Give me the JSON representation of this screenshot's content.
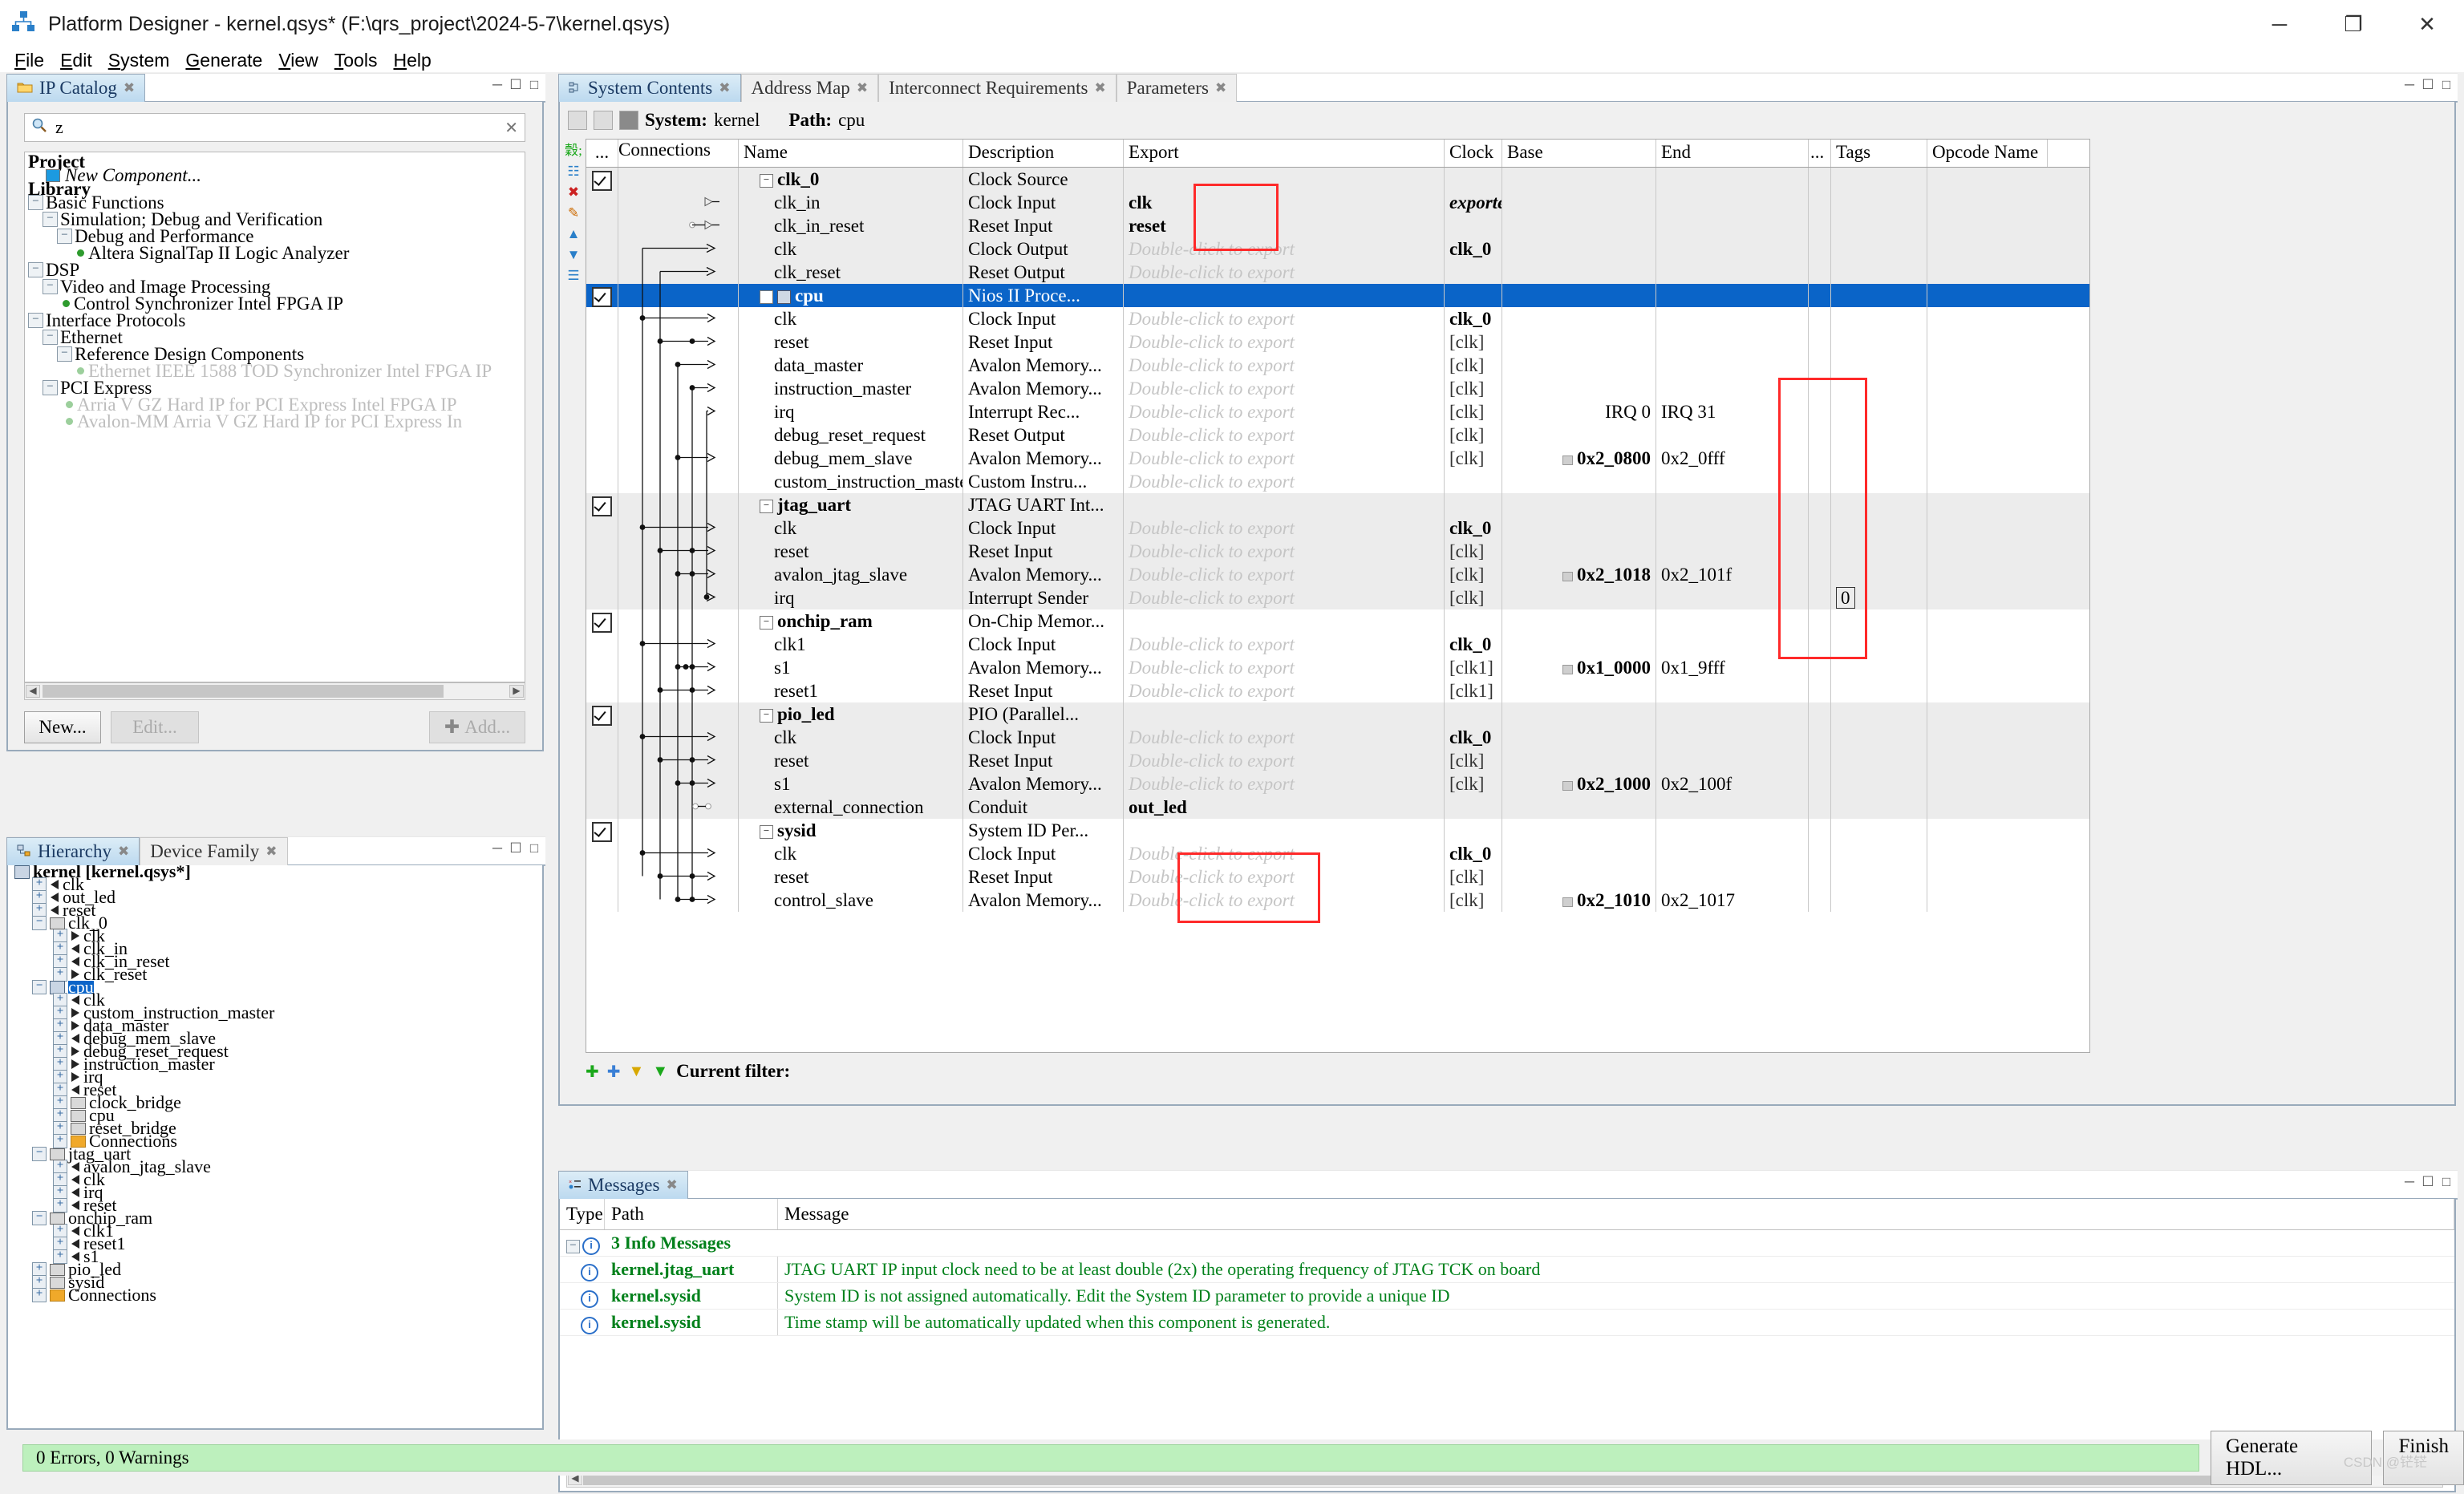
{
  "window": {
    "title": "Platform Designer - kernel.qsys* (F:\\qrs_project\\2024-5-7\\kernel.qsys)",
    "icon": "platform-designer-icon",
    "minimize": "─",
    "maximize": "❐",
    "close": "✕"
  },
  "menubar": [
    {
      "label": "File",
      "mnemonic": "F"
    },
    {
      "label": "Edit",
      "mnemonic": "E"
    },
    {
      "label": "System",
      "mnemonic": "S"
    },
    {
      "label": "Generate",
      "mnemonic": "G"
    },
    {
      "label": "View",
      "mnemonic": "V"
    },
    {
      "label": "Tools",
      "mnemonic": "T"
    },
    {
      "label": "Help",
      "mnemonic": "H"
    }
  ],
  "ip_catalog": {
    "tab_label": "IP Catalog",
    "search_value": "z",
    "search_placeholder": "",
    "tree": [
      {
        "label": "Project",
        "indent": 0,
        "style": "bold",
        "kind": "group"
      },
      {
        "label": "New Component...",
        "indent": 1,
        "style": "italic",
        "kind": "new"
      },
      {
        "label": "Library",
        "indent": 0,
        "style": "bold",
        "kind": "group"
      },
      {
        "label": "Basic Functions",
        "indent": 0,
        "style": "normal",
        "kind": "expander",
        "expander": "-"
      },
      {
        "label": "Simulation; Debug and Verification",
        "indent": 1,
        "style": "normal",
        "kind": "expander",
        "expander": "-"
      },
      {
        "label": "Debug and Performance",
        "indent": 2,
        "style": "normal",
        "kind": "expander",
        "expander": "-"
      },
      {
        "label": "Altera SignalTap II Logic Analyzer",
        "indent": 3,
        "style": "normal",
        "kind": "leaf"
      },
      {
        "label": "DSP",
        "indent": 0,
        "style": "normal",
        "kind": "expander",
        "expander": "-"
      },
      {
        "label": "Video and Image Processing",
        "indent": 1,
        "style": "normal",
        "kind": "expander",
        "expander": "-"
      },
      {
        "label": "Control Synchronizer Intel FPGA IP",
        "indent": 2,
        "style": "normal",
        "kind": "leaf"
      },
      {
        "label": "Interface Protocols",
        "indent": 0,
        "style": "normal",
        "kind": "expander",
        "expander": "-"
      },
      {
        "label": "Ethernet",
        "indent": 1,
        "style": "normal",
        "kind": "expander",
        "expander": "-"
      },
      {
        "label": "Reference Design Components",
        "indent": 2,
        "style": "normal",
        "kind": "expander",
        "expander": "-"
      },
      {
        "label": "Ethernet IEEE 1588 TOD Synchronizer Intel FPGA IP",
        "indent": 3,
        "style": "grey",
        "kind": "leaf-grey"
      },
      {
        "label": "PCI Express",
        "indent": 1,
        "style": "normal",
        "kind": "expander",
        "expander": "-"
      },
      {
        "label": "Arria V GZ Hard IP for PCI Express Intel FPGA IP",
        "indent": 2,
        "style": "grey",
        "kind": "leaf-grey"
      },
      {
        "label": "Avalon-MM Arria V GZ Hard IP for PCI Express In",
        "indent": 2,
        "style": "grey",
        "kind": "leaf-grey"
      }
    ],
    "buttons": {
      "new": "New...",
      "edit": "Edit...",
      "add": "Add..."
    }
  },
  "hierarchy": {
    "tabs": [
      {
        "label": "Hierarchy",
        "active": true
      },
      {
        "label": "Device Family",
        "active": false
      }
    ],
    "tree": [
      {
        "label": "kernel [kernel.qsys*]",
        "indent": 0,
        "icon": "system",
        "toggle": "",
        "bold": true
      },
      {
        "label": "clk",
        "indent": 1,
        "icon": "port-out",
        "toggle": "+"
      },
      {
        "label": "out_led",
        "indent": 1,
        "icon": "port-out",
        "toggle": "+"
      },
      {
        "label": "reset",
        "indent": 1,
        "icon": "port-out",
        "toggle": "+"
      },
      {
        "label": "clk_0",
        "indent": 1,
        "icon": "module",
        "toggle": "-"
      },
      {
        "label": "clk",
        "indent": 2,
        "icon": "port-in",
        "toggle": "+"
      },
      {
        "label": "clk_in",
        "indent": 2,
        "icon": "port-out",
        "toggle": "+"
      },
      {
        "label": "clk_in_reset",
        "indent": 2,
        "icon": "port-out",
        "toggle": "+"
      },
      {
        "label": "clk_reset",
        "indent": 2,
        "icon": "port-in",
        "toggle": "+"
      },
      {
        "label": "cpu",
        "indent": 1,
        "icon": "system",
        "toggle": "-",
        "selected": true
      },
      {
        "label": "clk",
        "indent": 2,
        "icon": "port-out",
        "toggle": "+"
      },
      {
        "label": "custom_instruction_master",
        "indent": 2,
        "icon": "port-in",
        "toggle": "+"
      },
      {
        "label": "data_master",
        "indent": 2,
        "icon": "port-in",
        "toggle": "+"
      },
      {
        "label": "debug_mem_slave",
        "indent": 2,
        "icon": "port-out",
        "toggle": "+"
      },
      {
        "label": "debug_reset_request",
        "indent": 2,
        "icon": "port-in",
        "toggle": "+"
      },
      {
        "label": "instruction_master",
        "indent": 2,
        "icon": "port-in",
        "toggle": "+"
      },
      {
        "label": "irq",
        "indent": 2,
        "icon": "port-in",
        "toggle": "+"
      },
      {
        "label": "reset",
        "indent": 2,
        "icon": "port-out",
        "toggle": "+"
      },
      {
        "label": "clock_bridge",
        "indent": 2,
        "icon": "module",
        "toggle": "+"
      },
      {
        "label": "cpu",
        "indent": 2,
        "icon": "module",
        "toggle": "+"
      },
      {
        "label": "reset_bridge",
        "indent": 2,
        "icon": "module",
        "toggle": "+"
      },
      {
        "label": "Connections",
        "indent": 2,
        "icon": "folder",
        "toggle": "+"
      },
      {
        "label": "jtag_uart",
        "indent": 1,
        "icon": "module",
        "toggle": "-"
      },
      {
        "label": "avalon_jtag_slave",
        "indent": 2,
        "icon": "port-out",
        "toggle": "+"
      },
      {
        "label": "clk",
        "indent": 2,
        "icon": "port-out",
        "toggle": "+"
      },
      {
        "label": "irq",
        "indent": 2,
        "icon": "port-out",
        "toggle": "+"
      },
      {
        "label": "reset",
        "indent": 2,
        "icon": "port-out",
        "toggle": "+"
      },
      {
        "label": "onchip_ram",
        "indent": 1,
        "icon": "module",
        "toggle": "-"
      },
      {
        "label": "clk1",
        "indent": 2,
        "icon": "port-out",
        "toggle": "+"
      },
      {
        "label": "reset1",
        "indent": 2,
        "icon": "port-out",
        "toggle": "+"
      },
      {
        "label": "s1",
        "indent": 2,
        "icon": "port-out",
        "toggle": "+"
      },
      {
        "label": "pio_led",
        "indent": 1,
        "icon": "module",
        "toggle": "+"
      },
      {
        "label": "sysid",
        "indent": 1,
        "icon": "module",
        "toggle": "+"
      },
      {
        "label": "Connections",
        "indent": 1,
        "icon": "folder",
        "toggle": "+"
      }
    ]
  },
  "system_contents": {
    "tabs": [
      {
        "label": "System Contents",
        "active": true
      },
      {
        "label": "Address Map",
        "active": false
      },
      {
        "label": "Interconnect Requirements",
        "active": false
      },
      {
        "label": "Parameters",
        "active": false
      }
    ],
    "toolbar": {
      "system_label": "System:",
      "system_value": "kernel",
      "path_label": "Path:",
      "path_value": "cpu"
    },
    "columns": [
      "...",
      "Connections",
      "Name",
      "Description",
      "Export",
      "Clock",
      "Base",
      "End",
      "...",
      "Tags",
      "Opcode Name"
    ],
    "rows": [
      {
        "use": true,
        "name": "clk_0",
        "level": 0,
        "desc": "Clock Source",
        "export": "",
        "clock": "",
        "base": "",
        "end": "",
        "tags": "",
        "opcode": "",
        "alt": true,
        "selected": false
      },
      {
        "use": null,
        "name": "clk_in",
        "level": 1,
        "desc": "Clock Input",
        "export": "clk",
        "clock": "exported",
        "base": "",
        "end": "",
        "tags": "",
        "opcode": "",
        "alt": true,
        "selected": false
      },
      {
        "use": null,
        "name": "clk_in_reset",
        "level": 1,
        "desc": "Reset Input",
        "export": "reset",
        "clock": "",
        "base": "",
        "end": "",
        "tags": "",
        "opcode": "",
        "alt": true,
        "selected": false
      },
      {
        "use": null,
        "name": "clk",
        "level": 1,
        "desc": "Clock Output",
        "export": "Double-click to export",
        "clock": "clk_0",
        "base": "",
        "end": "",
        "tags": "",
        "opcode": "",
        "alt": true,
        "selected": false
      },
      {
        "use": null,
        "name": "clk_reset",
        "level": 1,
        "desc": "Reset Output",
        "export": "Double-click to export",
        "clock": "",
        "base": "",
        "end": "",
        "tags": "",
        "opcode": "",
        "alt": true,
        "selected": false
      },
      {
        "use": true,
        "name": "cpu",
        "level": 0,
        "desc": "Nios II Proce...",
        "export": "",
        "clock": "",
        "base": "",
        "end": "",
        "tags": "",
        "opcode": "",
        "alt": false,
        "selected": true
      },
      {
        "use": null,
        "name": "clk",
        "level": 1,
        "desc": "Clock Input",
        "export": "Double-click to export",
        "clock": "clk_0",
        "base": "",
        "end": "",
        "tags": "",
        "opcode": "",
        "alt": false,
        "selected": false
      },
      {
        "use": null,
        "name": "reset",
        "level": 1,
        "desc": "Reset Input",
        "export": "Double-click to export",
        "clock": "[clk]",
        "base": "",
        "end": "",
        "tags": "",
        "opcode": "",
        "alt": false,
        "selected": false
      },
      {
        "use": null,
        "name": "data_master",
        "level": 1,
        "desc": "Avalon Memory...",
        "export": "Double-click to export",
        "clock": "[clk]",
        "base": "",
        "end": "",
        "tags": "",
        "opcode": "",
        "alt": false,
        "selected": false
      },
      {
        "use": null,
        "name": "instruction_master",
        "level": 1,
        "desc": "Avalon Memory...",
        "export": "Double-click to export",
        "clock": "[clk]",
        "base": "",
        "end": "",
        "tags": "",
        "opcode": "",
        "alt": false,
        "selected": false
      },
      {
        "use": null,
        "name": "irq",
        "level": 1,
        "desc": "Interrupt Rec...",
        "export": "Double-click to export",
        "clock": "[clk]",
        "base": "IRQ 0",
        "end": "IRQ 31",
        "tags": "",
        "opcode": "",
        "alt": false,
        "selected": false
      },
      {
        "use": null,
        "name": "debug_reset_request",
        "level": 1,
        "desc": "Reset Output",
        "export": "Double-click to export",
        "clock": "[clk]",
        "base": "",
        "end": "",
        "tags": "",
        "opcode": "",
        "alt": false,
        "selected": false
      },
      {
        "use": null,
        "name": "debug_mem_slave",
        "level": 1,
        "desc": "Avalon Memory...",
        "export": "Double-click to export",
        "clock": "[clk]",
        "base": "0x2_0800",
        "end": "0x2_0fff",
        "tags": "",
        "opcode": "",
        "alt": false,
        "selected": false,
        "lock": true
      },
      {
        "use": null,
        "name": "custom_instruction_master",
        "level": 1,
        "desc": "Custom Instru...",
        "export": "Double-click to export",
        "clock": "",
        "base": "",
        "end": "",
        "tags": "",
        "opcode": "",
        "alt": false,
        "selected": false
      },
      {
        "use": true,
        "name": "jtag_uart",
        "level": 0,
        "desc": "JTAG UART Int...",
        "export": "",
        "clock": "",
        "base": "",
        "end": "",
        "tags": "",
        "opcode": "",
        "alt": true,
        "selected": false
      },
      {
        "use": null,
        "name": "clk",
        "level": 1,
        "desc": "Clock Input",
        "export": "Double-click to export",
        "clock": "clk_0",
        "base": "",
        "end": "",
        "tags": "",
        "opcode": "",
        "alt": true,
        "selected": false
      },
      {
        "use": null,
        "name": "reset",
        "level": 1,
        "desc": "Reset Input",
        "export": "Double-click to export",
        "clock": "[clk]",
        "base": "",
        "end": "",
        "tags": "",
        "opcode": "",
        "alt": true,
        "selected": false
      },
      {
        "use": null,
        "name": "avalon_jtag_slave",
        "level": 1,
        "desc": "Avalon Memory...",
        "export": "Double-click to export",
        "clock": "[clk]",
        "base": "0x2_1018",
        "end": "0x2_101f",
        "tags": "",
        "opcode": "",
        "alt": true,
        "selected": false,
        "lock": true
      },
      {
        "use": null,
        "name": "irq",
        "level": 1,
        "desc": "Interrupt Sender",
        "export": "Double-click to export",
        "clock": "[clk]",
        "base": "",
        "end": "",
        "tags": "0",
        "opcode": "",
        "alt": true,
        "selected": false
      },
      {
        "use": true,
        "name": "onchip_ram",
        "level": 0,
        "desc": "On-Chip Memor...",
        "export": "",
        "clock": "",
        "base": "",
        "end": "",
        "tags": "",
        "opcode": "",
        "alt": false,
        "selected": false
      },
      {
        "use": null,
        "name": "clk1",
        "level": 1,
        "desc": "Clock Input",
        "export": "Double-click to export",
        "clock": "clk_0",
        "base": "",
        "end": "",
        "tags": "",
        "opcode": "",
        "alt": false,
        "selected": false
      },
      {
        "use": null,
        "name": "s1",
        "level": 1,
        "desc": "Avalon Memory...",
        "export": "Double-click to export",
        "clock": "[clk1]",
        "base": "0x1_0000",
        "end": "0x1_9fff",
        "tags": "",
        "opcode": "",
        "alt": false,
        "selected": false,
        "lock": true
      },
      {
        "use": null,
        "name": "reset1",
        "level": 1,
        "desc": "Reset Input",
        "export": "Double-click to export",
        "clock": "[clk1]",
        "base": "",
        "end": "",
        "tags": "",
        "opcode": "",
        "alt": false,
        "selected": false
      },
      {
        "use": true,
        "name": "pio_led",
        "level": 0,
        "desc": "PIO (Parallel...",
        "export": "",
        "clock": "",
        "base": "",
        "end": "",
        "tags": "",
        "opcode": "",
        "alt": true,
        "selected": false
      },
      {
        "use": null,
        "name": "clk",
        "level": 1,
        "desc": "Clock Input",
        "export": "Double-click to export",
        "clock": "clk_0",
        "base": "",
        "end": "",
        "tags": "",
        "opcode": "",
        "alt": true,
        "selected": false
      },
      {
        "use": null,
        "name": "reset",
        "level": 1,
        "desc": "Reset Input",
        "export": "Double-click to export",
        "clock": "[clk]",
        "base": "",
        "end": "",
        "tags": "",
        "opcode": "",
        "alt": true,
        "selected": false
      },
      {
        "use": null,
        "name": "s1",
        "level": 1,
        "desc": "Avalon Memory...",
        "export": "Double-click to export",
        "clock": "[clk]",
        "base": "0x2_1000",
        "end": "0x2_100f",
        "tags": "",
        "opcode": "",
        "alt": true,
        "selected": false,
        "lock": true
      },
      {
        "use": null,
        "name": "external_connection",
        "level": 1,
        "desc": "Conduit",
        "export": "out_led",
        "clock": "",
        "base": "",
        "end": "",
        "tags": "",
        "opcode": "",
        "alt": true,
        "selected": false
      },
      {
        "use": true,
        "name": "sysid",
        "level": 0,
        "desc": "System ID Per...",
        "export": "",
        "clock": "",
        "base": "",
        "end": "",
        "tags": "",
        "opcode": "",
        "alt": false,
        "selected": false
      },
      {
        "use": null,
        "name": "clk",
        "level": 1,
        "desc": "Clock Input",
        "export": "Double-click to export",
        "clock": "clk_0",
        "base": "",
        "end": "",
        "tags": "",
        "opcode": "",
        "alt": false,
        "selected": false
      },
      {
        "use": null,
        "name": "reset",
        "level": 1,
        "desc": "Reset Input",
        "export": "Double-click to export",
        "clock": "[clk]",
        "base": "",
        "end": "",
        "tags": "",
        "opcode": "",
        "alt": false,
        "selected": false
      },
      {
        "use": null,
        "name": "control_slave",
        "level": 1,
        "desc": "Avalon Memory...",
        "export": "Double-click to export",
        "clock": "[clk]",
        "base": "0x2_1010",
        "end": "0x2_1017",
        "tags": "",
        "opcode": "",
        "alt": false,
        "selected": false,
        "lock": true
      }
    ],
    "filter_label": "Current filter:",
    "filter_value": ""
  },
  "messages": {
    "tab_label": "Messages",
    "columns": {
      "type": "Type",
      "path": "Path",
      "message": "Message"
    },
    "group_label": "3 Info Messages",
    "rows": [
      {
        "path": "kernel.jtag_uart",
        "message": "JTAG UART IP input clock need to be at least double (2x) the operating frequency of JTAG TCK on board"
      },
      {
        "path": "kernel.sysid",
        "message": "System ID is not assigned automatically. Edit the System ID parameter to provide a unique ID"
      },
      {
        "path": "kernel.sysid",
        "message": "Time stamp will be automatically updated when this component is generated."
      }
    ]
  },
  "statusbar": {
    "message": "0 Errors, 0 Warnings",
    "generate_button": "Generate HDL...",
    "finish_button": "Finish",
    "watermark": "CSDN @铓铓"
  },
  "colors": {
    "selection_blue": "#0a64c8",
    "annotation_red": "#ff2a2a",
    "status_green": "#bdf0bd",
    "message_green": "#00801a",
    "panel_border": "#9ab"
  }
}
